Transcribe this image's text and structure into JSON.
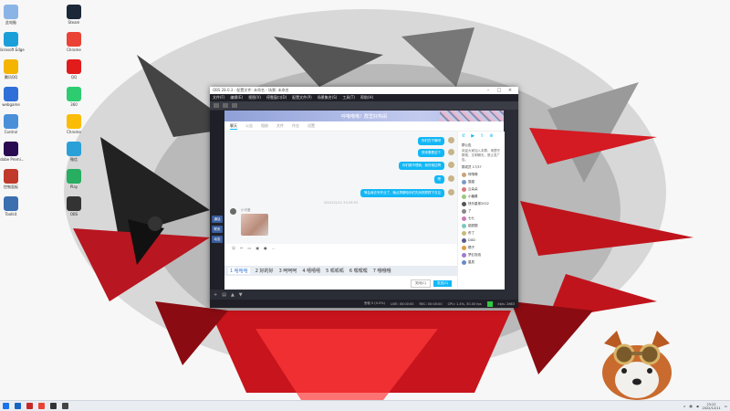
{
  "desktop": {
    "icons_left": [
      {
        "label": "此电脑",
        "color": "#8ab4e6",
        "icon": "computer-icon"
      },
      {
        "label": "Microsoft Edge",
        "color": "#1a9fd9",
        "icon": "edge-icon"
      },
      {
        "label": "腾讯QQ",
        "color": "#f5b400",
        "icon": "qq-icon"
      },
      {
        "label": "webgame",
        "color": "#2f6fd8",
        "icon": "globe-icon"
      },
      {
        "label": "Control",
        "color": "#4a90d9",
        "icon": "control-panel-icon"
      },
      {
        "label": "Adobe Premi...",
        "color": "#2a0a50",
        "icon": "premiere-icon"
      },
      {
        "label": "控制面板",
        "color": "#c0392b",
        "icon": "app-icon"
      },
      {
        "label": "Toolkit",
        "color": "#3b6fb0",
        "icon": "toolkit-icon"
      }
    ],
    "icons_right": [
      {
        "label": "Steam",
        "color": "#1b2838",
        "icon": "steam-icon"
      },
      {
        "label": "Chrome",
        "color": "#ea4335",
        "icon": "chrome-icon"
      },
      {
        "label": "QQ",
        "color": "#e21b1b",
        "icon": "qq-icon"
      },
      {
        "label": "360",
        "color": "#2ecc71",
        "icon": "app-icon"
      },
      {
        "label": "Chrome",
        "color": "#fbbc05",
        "icon": "chrome-icon"
      },
      {
        "label": "微信",
        "color": "#2aa0d8",
        "icon": "app-icon"
      },
      {
        "label": "Play",
        "color": "#27ae60",
        "icon": "play-icon"
      },
      {
        "label": "OBS",
        "color": "#333333",
        "icon": "obs-icon"
      }
    ]
  },
  "obs": {
    "title": "OBS 28.0.3 - 配置文件: 未命名 - 场景: 未命名",
    "menus": [
      "文件(F)",
      "编辑(E)",
      "视图(V)",
      "停靠窗口(D)",
      "配置文件(P)",
      "场景集合(S)",
      "工具(T)",
      "帮助(H)"
    ],
    "leftbar": [
      "通话",
      "联系",
      "动态"
    ],
    "status": {
      "live": "LIVE: 00:00:00",
      "rec": "REC: 00:00:00",
      "cpu": "CPU: 1.4%, 30.00 fps",
      "kb": "kb/s: 2663",
      "frames": "丢帧 0 (0.0%)"
    }
  },
  "qq": {
    "group_title": "呼噜噜噜！群里好热闹",
    "tabs": [
      "聊天",
      "公告",
      "相册",
      "文件",
      "作业",
      "设置"
    ],
    "messages": [
      {
        "text": "你们在干嘛呀"
      },
      {
        "text": "快来看看这个"
      },
      {
        "text": "你们都不理我，我好难过啊"
      },
      {
        "text": "嗯"
      },
      {
        "text": "等会我去写作业了，晚点再聊哈你们先玩吧拜拜下次见"
      }
    ],
    "timestamp": "2022/12/11 23:19:53",
    "sender_name": "小可爱",
    "ime_candidates": [
      "1 哈哈哈",
      "2 好的好",
      "3 呵呵呵",
      "4 嘻嘻嘻",
      "5 呱呱呱",
      "6 嘿嘿嘿",
      "7 哦哦哦"
    ],
    "close_label": "关闭(C)",
    "send_label": "发送(S)",
    "announcement_title": "群公告",
    "announcement": "欢迎大家加入本群，请遵守群规，文明聊天，禁止发广告。",
    "members_title": "群成员 17/37",
    "members": [
      {
        "name": "呼噜噜",
        "color": "#c9a27a"
      },
      {
        "name": "猫猫",
        "color": "#7a9bc9"
      },
      {
        "name": "云朵朵",
        "color": "#d67a7a"
      },
      {
        "name": "小糖果",
        "color": "#9ac97a"
      },
      {
        "name": "快乐星球2022",
        "color": "#555555"
      },
      {
        "name": "了",
        "color": "#888888"
      },
      {
        "name": "七七",
        "color": "#c97ab8"
      },
      {
        "name": "甜甜圈",
        "color": "#7ac9c0"
      },
      {
        "name": "布丁",
        "color": "#c9b87a"
      },
      {
        "name": "DXD",
        "color": "#5a5a8a"
      },
      {
        "name": "橘子",
        "color": "#e09a40"
      },
      {
        "name": "梦幻泡泡",
        "color": "#a07ac9"
      },
      {
        "name": "星辰",
        "color": "#6a8ac9"
      }
    ]
  },
  "taskbar": {
    "time": "23:22",
    "date": "2022/12/11"
  }
}
